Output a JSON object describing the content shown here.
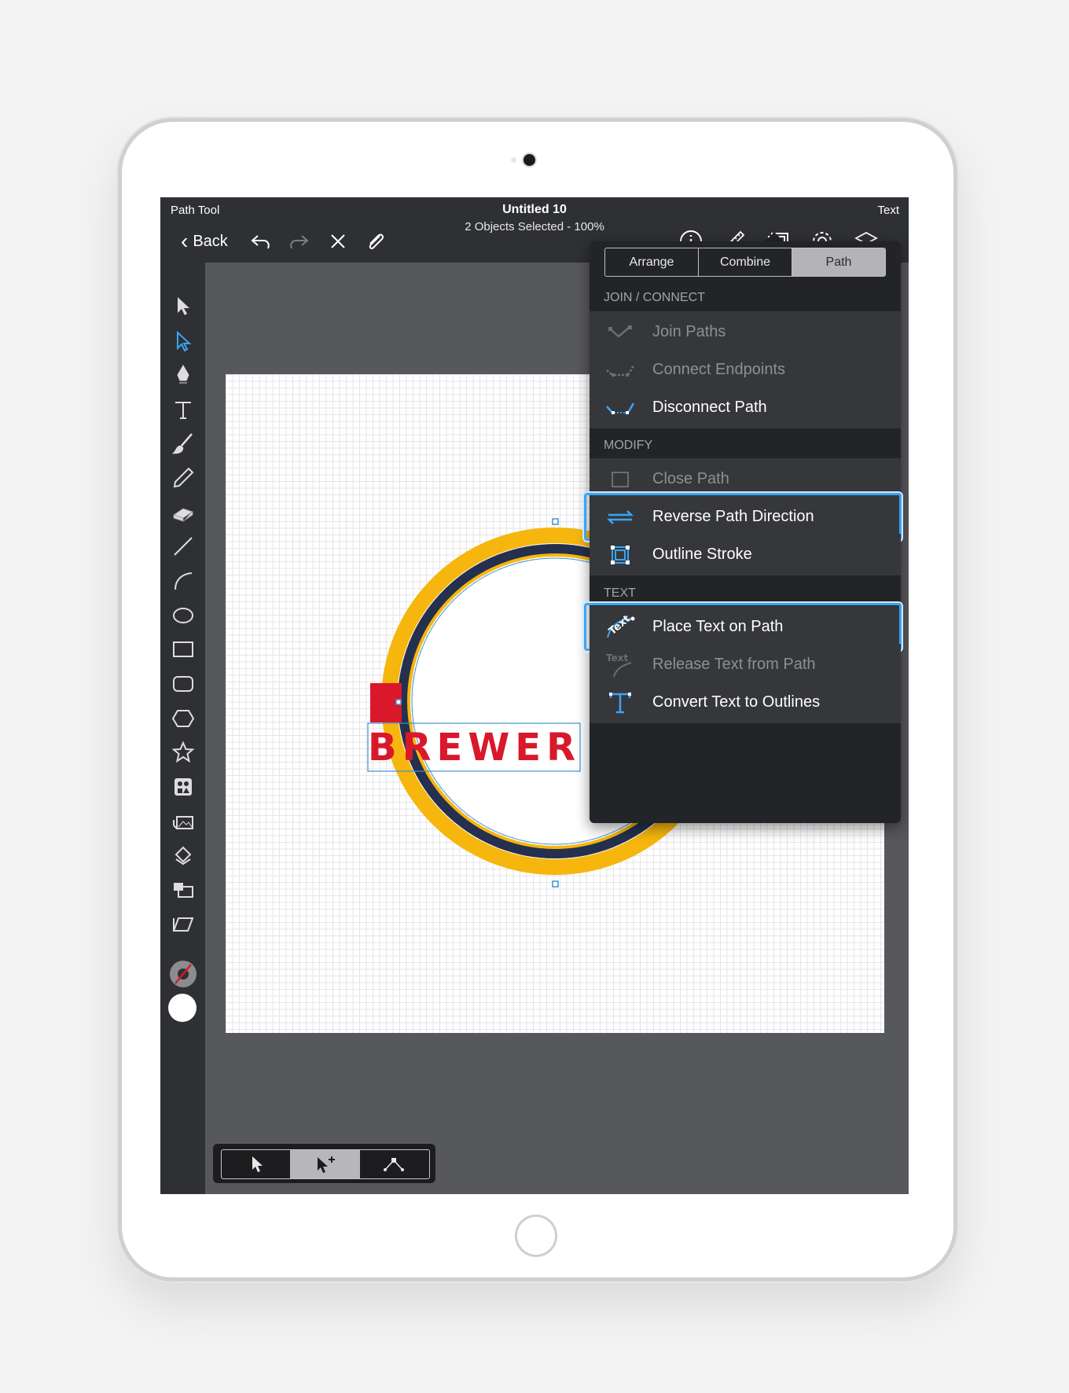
{
  "topbar": {
    "left_title": "Path Tool",
    "back_label": "Back",
    "doc_title": "Untitled 10",
    "subtitle": "2 Objects Selected - 100%",
    "right_title": "Text"
  },
  "canvas": {
    "badge_text": "BREWER",
    "colors": {
      "outer_ring": "#f6b60d",
      "inner_ring": "#25304f",
      "text": "#d9182b",
      "selection": "#3d93d1"
    }
  },
  "popover": {
    "tabs": [
      "Arrange",
      "Combine",
      "Path"
    ],
    "selected_tab": "Path",
    "sections": {
      "join_connect": "JOIN / CONNECT",
      "modify": "MODIFY",
      "text": "TEXT"
    },
    "items": {
      "join_paths": "Join Paths",
      "connect_endpoints": "Connect Endpoints",
      "disconnect_path": "Disconnect Path",
      "close_path": "Close Path",
      "reverse_path_direction": "Reverse Path Direction",
      "outline_stroke": "Outline Stroke",
      "place_text_on_path": "Place Text on Path",
      "release_text_from_path": "Release Text from Path",
      "convert_text_to_outlines": "Convert Text to Outlines"
    },
    "accent": "#3aa5f2"
  },
  "tools": [
    "select-arrow",
    "direct-select",
    "pen",
    "text",
    "brush",
    "pencil",
    "eraser",
    "line",
    "arc",
    "ellipse",
    "rectangle",
    "rounded-rectangle",
    "hexagon",
    "star",
    "symbols",
    "images",
    "transform",
    "arrange",
    "skew"
  ],
  "selection_modes": [
    "select",
    "add-select",
    "node-select"
  ],
  "active_selection_mode": "add-select"
}
